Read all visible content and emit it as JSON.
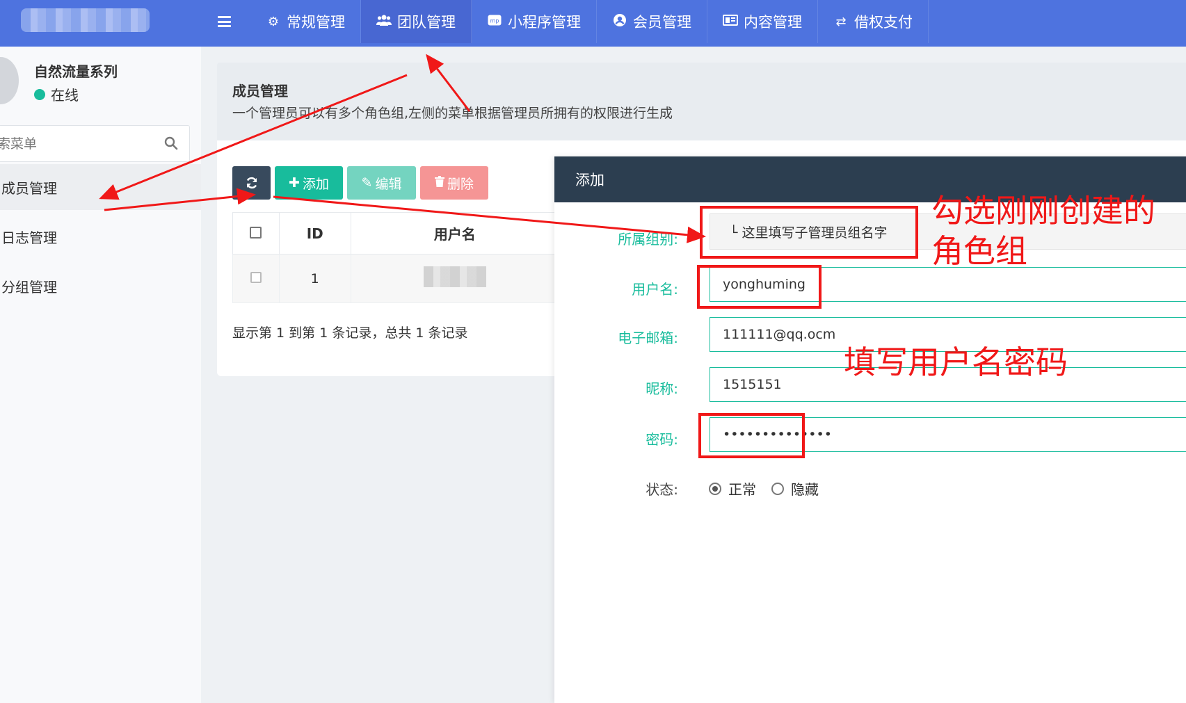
{
  "topnav": {
    "items": [
      {
        "label": "常规管理",
        "icon": "cogs-icon"
      },
      {
        "label": "团队管理",
        "icon": "users-icon"
      },
      {
        "label": "小程序管理",
        "icon": "miniprogram-icon"
      },
      {
        "label": "会员管理",
        "icon": "user-circle-icon"
      },
      {
        "label": "内容管理",
        "icon": "newspaper-icon"
      },
      {
        "label": "借权支付",
        "icon": "exchange-icon"
      }
    ],
    "active_index": 1
  },
  "sidebar": {
    "user_name": "自然流量系列",
    "status": "在线",
    "search_placeholder": "搜索菜单",
    "items": [
      {
        "label": "成员管理"
      },
      {
        "label": "日志管理"
      },
      {
        "label": "分组管理"
      }
    ]
  },
  "panel": {
    "title": "成员管理",
    "description": "一个管理员可以有多个角色组,左侧的菜单根据管理员所拥有的权限进行生成"
  },
  "toolbar": {
    "add_label": "添加",
    "edit_label": "编辑",
    "delete_label": "删除"
  },
  "table": {
    "columns": [
      "ID",
      "用户名"
    ],
    "rows": [
      {
        "id": "1"
      }
    ]
  },
  "pagination": {
    "text": "显示第 1 到第 1 条记录，总共 1 条记录"
  },
  "modal": {
    "title": "添加",
    "labels": {
      "group": "所属组别:",
      "username": "用户名:",
      "email": "电子邮箱:",
      "nickname": "昵称:",
      "password": "密码:",
      "status": "状态:"
    },
    "group_value": "└ 这里填写子管理员组名字",
    "username_value": "yonghuming",
    "email_value": "111111@qq.ocm",
    "nickname_value": "1515151",
    "password_value": "••••••••••••••",
    "status_options": [
      "正常",
      "隐藏"
    ],
    "status_selected": "正常"
  },
  "annotations": {
    "note1_line1": "勾选刚刚创建的",
    "note1_line2": "角色组",
    "note2": "填写用户名密码",
    "color": "#f01818"
  },
  "colors": {
    "topbar": "#4e73df",
    "primary_green": "#18bc9c",
    "dark": "#2c3e50",
    "danger": "#f59595"
  }
}
